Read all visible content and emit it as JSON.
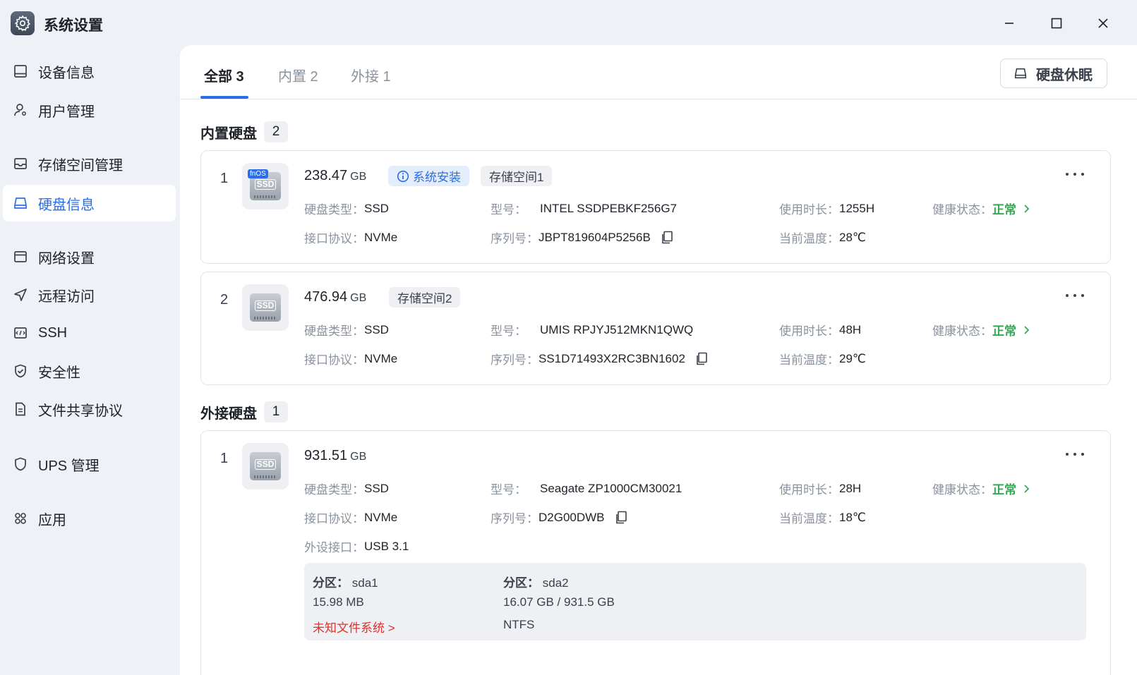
{
  "app": {
    "title": "系统设置"
  },
  "sidebar": {
    "items": [
      {
        "label": "设备信息",
        "icon": "device-icon"
      },
      {
        "label": "用户管理",
        "icon": "user-settings-icon"
      },
      {
        "label": "存储空间管理",
        "icon": "storage-icon"
      },
      {
        "label": "硬盘信息",
        "icon": "disk-icon",
        "active": true
      },
      {
        "label": "网络设置",
        "icon": "network-icon"
      },
      {
        "label": "远程访问",
        "icon": "send-icon"
      },
      {
        "label": "SSH",
        "icon": "terminal-icon"
      },
      {
        "label": "安全性",
        "icon": "shield-check-icon"
      },
      {
        "label": "文件共享协议",
        "icon": "document-icon"
      },
      {
        "label": "UPS 管理",
        "icon": "shield-icon"
      },
      {
        "label": "应用",
        "icon": "apps-icon"
      }
    ]
  },
  "tabs": [
    {
      "label": "全部 3",
      "active": true
    },
    {
      "label": "内置 2"
    },
    {
      "label": "外接 1"
    }
  ],
  "toolbar": {
    "sleep_label": "硬盘休眠"
  },
  "internal": {
    "title": "内置硬盘",
    "count": "2",
    "disks": [
      {
        "index": "1",
        "capacity": "238.47",
        "unit": "GB",
        "icon_badge": "fnOS",
        "icon_label": "SSD",
        "tags": [
          "系统安装",
          "存储空间1"
        ],
        "type_key": "硬盘类型：",
        "type": "SSD",
        "model_key": "型号：",
        "model": "INTEL SSDPEBKF256G7",
        "hours_key": "使用时长：",
        "hours": "1255H",
        "health_key": "健康状态：",
        "health": "正常",
        "iface_key": "接口协议：",
        "iface": "NVMe",
        "serial_key": "序列号：",
        "serial": "JBPT819604P5256B",
        "temp_key": "当前温度：",
        "temp": "28℃"
      },
      {
        "index": "2",
        "capacity": "476.94",
        "unit": "GB",
        "icon_label": "SSD",
        "tags": [
          "存储空间2"
        ],
        "type_key": "硬盘类型：",
        "type": "SSD",
        "model_key": "型号：",
        "model": "UMIS RPJYJ512MKN1QWQ",
        "hours_key": "使用时长：",
        "hours": "48H",
        "health_key": "健康状态：",
        "health": "正常",
        "iface_key": "接口协议：",
        "iface": "NVMe",
        "serial_key": "序列号：",
        "serial": "SS1D71493X2RC3BN1602",
        "temp_key": "当前温度：",
        "temp": "29℃"
      }
    ]
  },
  "external": {
    "title": "外接硬盘",
    "count": "1",
    "disks": [
      {
        "index": "1",
        "capacity": "931.51",
        "unit": "GB",
        "icon_label": "SSD",
        "type_key": "硬盘类型：",
        "type": "SSD",
        "model_key": "型号：",
        "model": "Seagate ZP1000CM30021",
        "hours_key": "使用时长：",
        "hours": "28H",
        "health_key": "健康状态：",
        "health": "正常",
        "iface_key": "接口协议：",
        "iface": "NVMe",
        "serial_key": "序列号：",
        "serial": "D2G00DWB",
        "temp_key": "当前温度：",
        "temp": "18℃",
        "port_key": "外设接口：",
        "port": "USB 3.1",
        "partitions": [
          {
            "key": "分区：",
            "name": "sda1",
            "size": "15.98 MB",
            "fs": "未知文件系统 >"
          },
          {
            "key": "分区：",
            "name": "sda2",
            "size": "16.07 GB / 931.5 GB",
            "fs": "NTFS"
          }
        ]
      }
    ]
  },
  "colors": {
    "accent": "#2b6de8",
    "healthy": "#34a853",
    "error": "#e0312b"
  }
}
